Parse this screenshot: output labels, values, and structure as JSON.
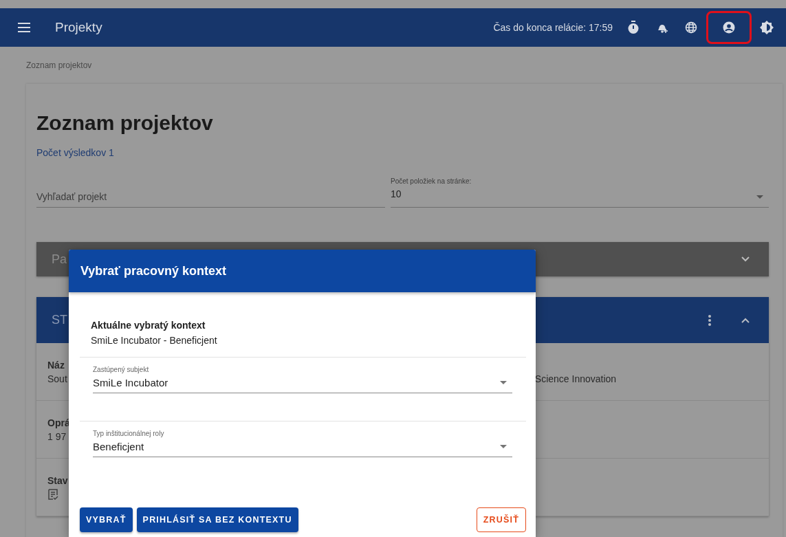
{
  "top_bar": {
    "title": "Projekty",
    "session_timer": "Čas do konca relácie: 17:59",
    "icons": [
      {
        "kind": "stopwatch",
        "highlighted": false
      },
      {
        "kind": "bell",
        "highlighted": false
      },
      {
        "kind": "globe",
        "highlighted": false
      },
      {
        "kind": "account",
        "highlighted": true
      },
      {
        "kind": "theme",
        "highlighted": false
      }
    ]
  },
  "breadcrumb": "Zoznam projektov",
  "page": {
    "heading": "Zoznam projektov",
    "result_count": "Počet výsledkov 1",
    "search": {
      "placeholder": "Vyhľadať projekt"
    },
    "page_size": {
      "label": "Počet položiek na stránke:",
      "value": "10"
    },
    "filter_panel": {
      "title": "Pa",
      "expanded": false
    },
    "project_card": {
      "title": "ST",
      "expanded": true,
      "rows": [
        {
          "kind": "text",
          "label": "Náz",
          "value": "Sout",
          "value_end": "Science Innovation"
        },
        {
          "kind": "text",
          "label": "Oprá",
          "value": "1 97"
        },
        {
          "kind": "icon",
          "label": "Stav"
        }
      ]
    }
  },
  "dialog": {
    "title": "Vybrať pracovný kontext",
    "current_label": "Aktuálne vybratý kontext",
    "current_value": "SmiLe Incubator - Beneficjent",
    "fields": [
      {
        "label": "Zastúpený subjekt",
        "value": "SmiLe Incubator"
      },
      {
        "label": "Typ inštitucionálnej roly",
        "value": "Beneficjent"
      }
    ],
    "buttons": [
      {
        "kind": "primary",
        "label": "VYBRAŤ"
      },
      {
        "kind": "primary",
        "label": "PRIHLÁSIŤ SA BEZ KONTEXTU"
      },
      {
        "kind": "outline",
        "label": "ZRUŠIŤ"
      }
    ]
  }
}
